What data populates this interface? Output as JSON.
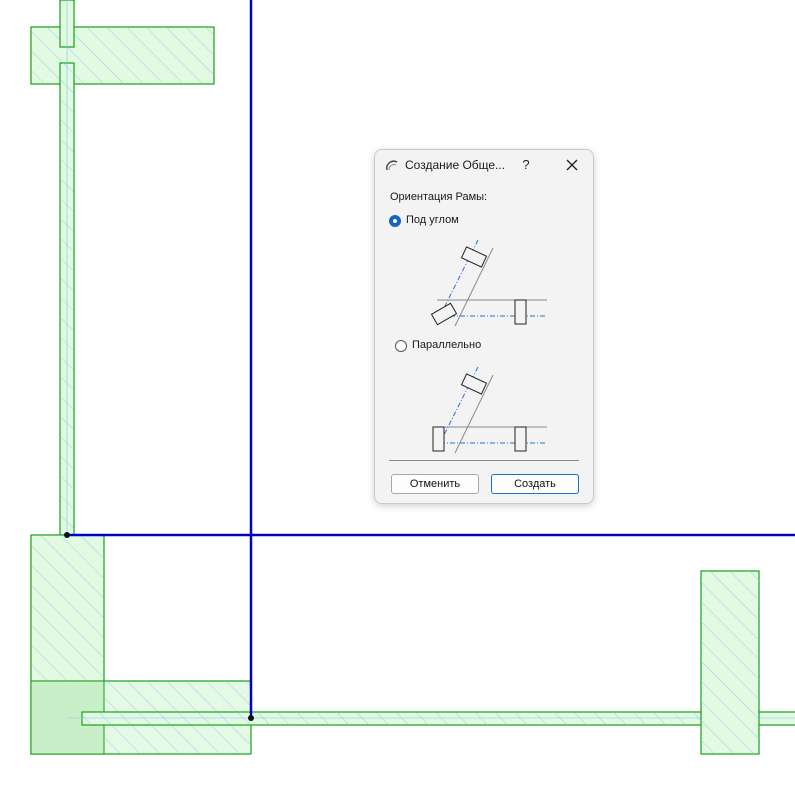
{
  "dialog": {
    "title": "Создание Обще...",
    "help_label": "?",
    "section_label": "Ориентация Рамы:",
    "options": [
      {
        "label": "Под углом",
        "selected": true
      },
      {
        "label": "Параллельно",
        "selected": false
      }
    ],
    "cancel_label": "Отменить",
    "create_label": "Создать"
  },
  "colors": {
    "grid_line": "#0000cc",
    "wall_fill": "#e2f9e2",
    "wall_stroke": "#1a9e1a",
    "hatch": "#7ec8f0",
    "accent": "#1565c0"
  },
  "icons": [
    "arc-app-icon",
    "close-icon",
    "angled-frame-diagram",
    "parallel-frame-diagram"
  ]
}
